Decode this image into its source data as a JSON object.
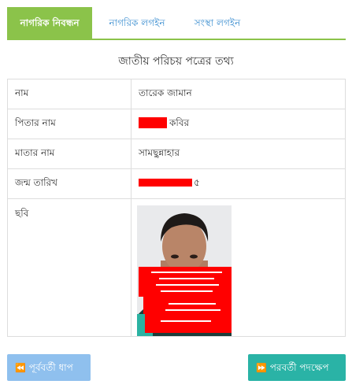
{
  "tabs": [
    {
      "label": "নাগরিক নিবন্ধন",
      "active": true
    },
    {
      "label": "নাগরিক লগইন",
      "active": false
    },
    {
      "label": "সংস্থা লগইন",
      "active": false
    }
  ],
  "section_title": "জাতীয় পরিচয় পত্রের তথ্য",
  "fields": {
    "name": {
      "label": "নাম",
      "value": "তারেক জামান"
    },
    "father": {
      "label": "পিতার নাম",
      "value": "কবির"
    },
    "mother": {
      "label": "মাতার নাম",
      "value": "সামছুন্নাহার"
    },
    "dob": {
      "label": "জন্ম তারিখ",
      "value": "৫"
    },
    "photo": {
      "label": "ছবি"
    }
  },
  "buttons": {
    "prev": {
      "label": "পূর্ববর্তী ধাপ",
      "icon": "double-chevron-left-icon"
    },
    "next": {
      "label": "পরবর্তী পদক্ষেপ",
      "icon": "double-chevron-right-icon"
    }
  },
  "colors": {
    "accent": "#8bc34a",
    "link": "#3b8ed0",
    "prev_button": "#8fc0ee",
    "next_button": "#2ab3a6",
    "redaction": "#ff0000"
  }
}
